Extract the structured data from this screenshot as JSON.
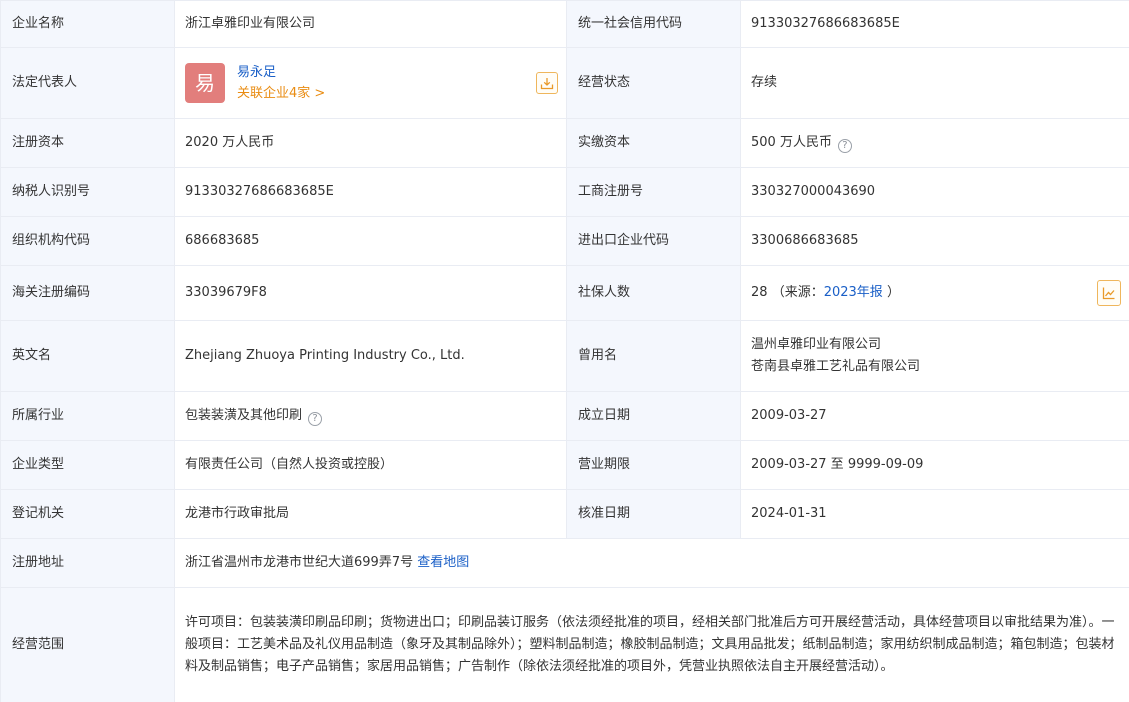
{
  "rows": {
    "company_name": {
      "label": "企业名称",
      "value": "浙江卓雅印业有限公司"
    },
    "credit_code": {
      "label": "统一社会信用代码",
      "value": "91330327686683685E"
    },
    "legal_rep": {
      "label": "法定代表人",
      "avatar_char": "易",
      "name": "易永足",
      "related": "关联企业4家 >"
    },
    "status": {
      "label": "经营状态",
      "value": "存续"
    },
    "reg_capital": {
      "label": "注册资本",
      "value": "2020 万人民币"
    },
    "paid_capital": {
      "label": "实缴资本",
      "value": "500 万人民币"
    },
    "taxpayer_id": {
      "label": "纳税人识别号",
      "value": "91330327686683685E"
    },
    "business_reg_no": {
      "label": "工商注册号",
      "value": "330327000043690"
    },
    "org_code": {
      "label": "组织机构代码",
      "value": "686683685"
    },
    "import_export_code": {
      "label": "进出口企业代码",
      "value": "3300686683685"
    },
    "customs_code": {
      "label": "海关注册编码",
      "value": "33039679F8"
    },
    "social_insurance": {
      "label": "社保人数",
      "count": "28",
      "source_prefix": "（来源：",
      "source_link": "2023年报",
      "source_suffix": "）"
    },
    "english_name": {
      "label": "英文名",
      "value": "Zhejiang Zhuoya Printing Industry Co., Ltd."
    },
    "former_names": {
      "label": "曾用名",
      "values": [
        "温州卓雅印业有限公司",
        "苍南县卓雅工艺礼品有限公司"
      ]
    },
    "industry": {
      "label": "所属行业",
      "value": "包装装潢及其他印刷"
    },
    "established": {
      "label": "成立日期",
      "value": "2009-03-27"
    },
    "company_type": {
      "label": "企业类型",
      "value": "有限责任公司（自然人投资或控股）"
    },
    "business_term": {
      "label": "营业期限",
      "value": "2009-03-27 至 9999-09-09"
    },
    "reg_authority": {
      "label": "登记机关",
      "value": "龙港市行政审批局"
    },
    "approval_date": {
      "label": "核准日期",
      "value": "2024-01-31"
    },
    "reg_address": {
      "label": "注册地址",
      "value": "浙江省温州市龙港市世纪大道699弄7号",
      "map_link": "查看地图"
    },
    "business_scope": {
      "label": "经营范围",
      "value": "许可项目：包装装潢印刷品印刷；货物进出口；印刷品装订服务（依法须经批准的项目，经相关部门批准后方可开展经营活动，具体经营项目以审批结果为准）。一般项目：工艺美术品及礼仪用品制造（象牙及其制品除外）；塑料制品制造；橡胶制品制造；文具用品批发；纸制品制造；家用纺织制成品制造；箱包制造；包装材料及制品销售；电子产品销售；家居用品销售；广告制作（除依法须经批准的项目外，凭营业执照依法自主开展经营活动）。"
    }
  },
  "icons": {
    "export": "download-icon",
    "chart": "trend-chart-icon",
    "help": "question-icon"
  },
  "colors": {
    "label_bg": "#f4f7fd",
    "border": "#e9ecf3",
    "link": "#1a5fc7",
    "orange": "#e98c12",
    "avatar": "#e27e7c"
  }
}
